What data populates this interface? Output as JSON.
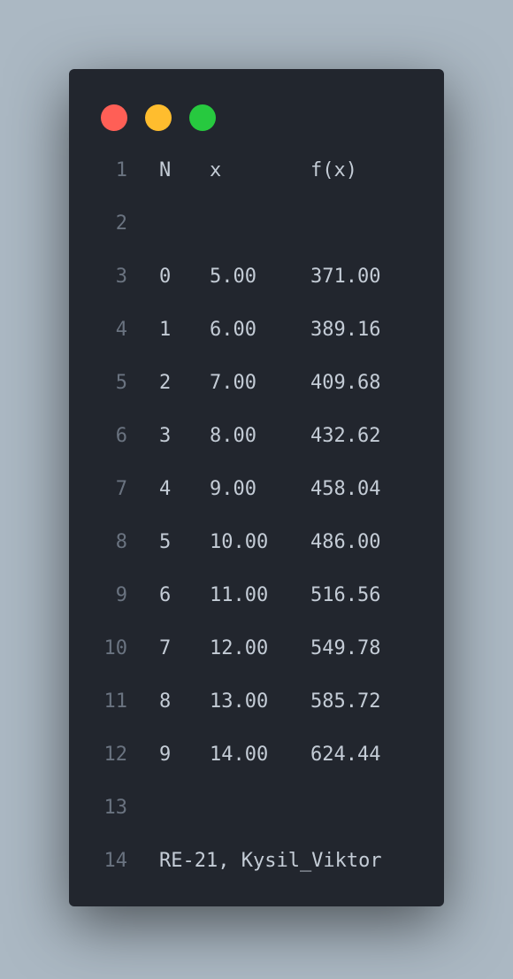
{
  "window_controls": {
    "close_color": "#ff5f56",
    "minimize_color": "#ffbd2e",
    "maximize_color": "#27c93f"
  },
  "lines": [
    {
      "num": "1",
      "n": "N",
      "x": "x",
      "fx": "f(x)"
    },
    {
      "num": "2",
      "n": "",
      "x": "",
      "fx": ""
    },
    {
      "num": "3",
      "n": "0",
      "x": "5.00",
      "fx": "371.00"
    },
    {
      "num": "4",
      "n": "1",
      "x": "6.00",
      "fx": "389.16"
    },
    {
      "num": "5",
      "n": "2",
      "x": "7.00",
      "fx": "409.68"
    },
    {
      "num": "6",
      "n": "3",
      "x": "8.00",
      "fx": "432.62"
    },
    {
      "num": "7",
      "n": "4",
      "x": "9.00",
      "fx": "458.04"
    },
    {
      "num": "8",
      "n": "5",
      "x": "10.00",
      "fx": "486.00"
    },
    {
      "num": "9",
      "n": "6",
      "x": "11.00",
      "fx": "516.56"
    },
    {
      "num": "10",
      "n": "7",
      "x": "12.00",
      "fx": "549.78"
    },
    {
      "num": "11",
      "n": "8",
      "x": "13.00",
      "fx": "585.72"
    },
    {
      "num": "12",
      "n": "9",
      "x": "14.00",
      "fx": "624.44"
    },
    {
      "num": "13",
      "n": "",
      "x": "",
      "fx": ""
    },
    {
      "num": "14",
      "text": "RE-21, Kysil_Viktor"
    }
  ]
}
